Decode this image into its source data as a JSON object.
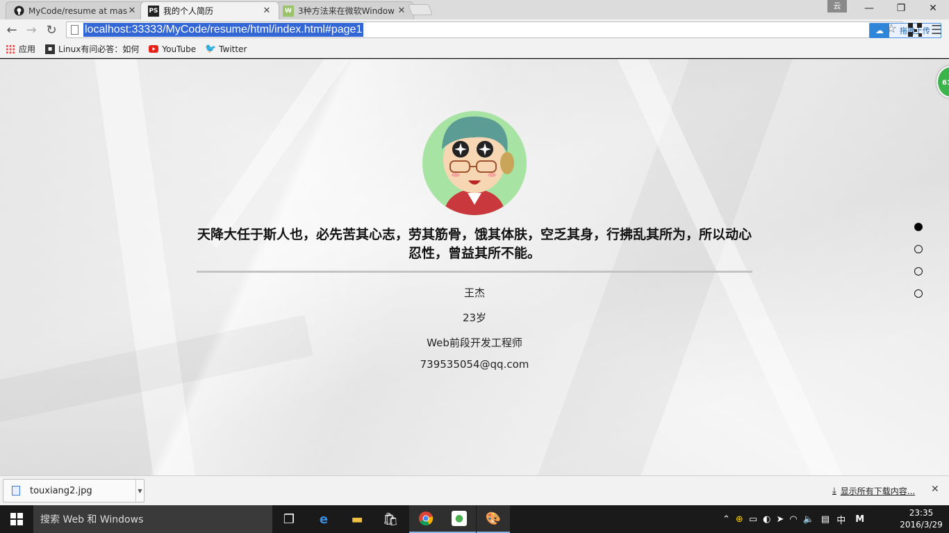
{
  "tabs": [
    {
      "title": "MyCode/resume at mas",
      "favicon": "github-icon",
      "active": false
    },
    {
      "title": "我的个人简历",
      "favicon": "ps-icon",
      "active": true
    },
    {
      "title": "3种方法来在微软Window",
      "favicon": "wikihow-icon",
      "active": false
    }
  ],
  "window": {
    "yun_label": "云"
  },
  "toolbar": {
    "url": "localhost:33333/MyCode/resume/html/index.html#page1",
    "upload_label": "拖拽上传"
  },
  "bookmarks": [
    {
      "label": "应用",
      "icon": "apps-icon"
    },
    {
      "label": "Linux有问必答：如何",
      "icon": "bookmark-icon"
    },
    {
      "label": "YouTube",
      "icon": "youtube-icon"
    },
    {
      "label": "Twitter",
      "icon": "twitter-icon"
    }
  ],
  "page": {
    "motto": "天降大任于斯人也，必先苦其心志，劳其筋骨，饿其体肤，空乏其身，行拂乱其所为，所以动心忍性，曾益其所不能。",
    "name": "王杰",
    "age": "23岁",
    "job": "Web前段开发工程师",
    "email": "739535054@qq.com",
    "float_badge": "61",
    "nav_dots": [
      true,
      false,
      false,
      false
    ]
  },
  "downloads": {
    "file": "touxiang2.jpg",
    "show_all": "显示所有下载内容..."
  },
  "taskbar": {
    "search_placeholder": "搜索 Web 和 Windows",
    "ime": "中",
    "ime2": "M",
    "time": "23:35",
    "date": "2016/3/29"
  }
}
